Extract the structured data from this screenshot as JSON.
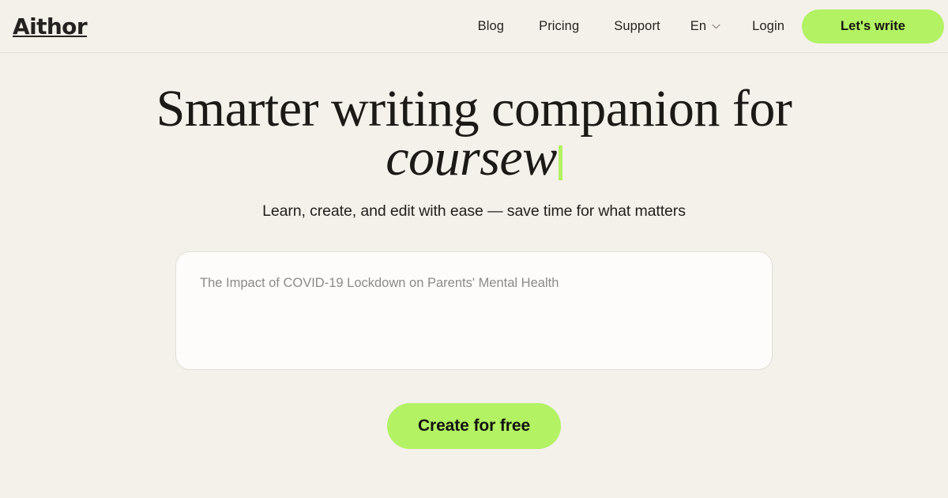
{
  "brand": {
    "logo_text": "Aithor"
  },
  "colors": {
    "page_background": "#F4F0EA",
    "accent_green": "#B2F263",
    "text_dark": "#1C1B19",
    "placeholder_gray": "#8C8A86",
    "border": "#E3DED5",
    "input_background": "#FDFCFA"
  },
  "header": {
    "nav": [
      {
        "label": "Blog"
      },
      {
        "label": "Pricing"
      },
      {
        "label": "Support"
      }
    ],
    "language": {
      "label": "En",
      "icon": "chevron-down-icon"
    },
    "login_label": "Login",
    "cta_label": "Let's write"
  },
  "hero": {
    "headline_line1": "Smarter writing companion for",
    "headline_line2": "coursew",
    "subtitle": "Learn, create, and edit with ease — save time for what matters",
    "prompt": {
      "value": "",
      "placeholder": "The Impact of COVID-19 Lockdown on Parents' Mental Health"
    },
    "cta_label": "Create for free"
  }
}
